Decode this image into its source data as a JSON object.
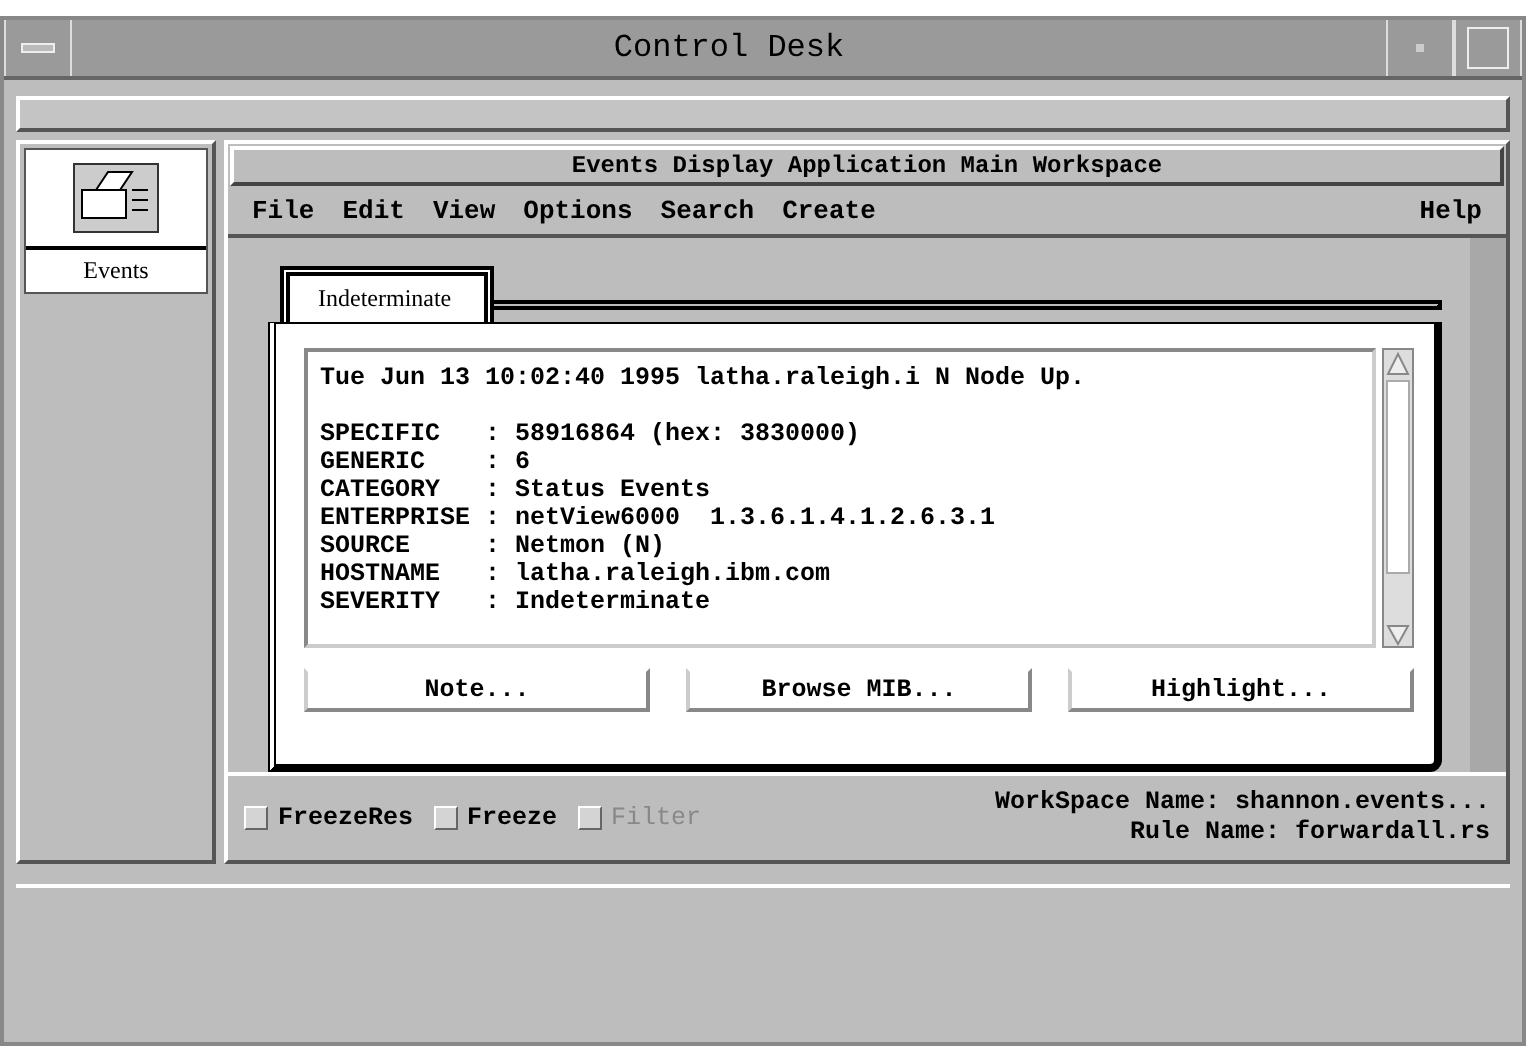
{
  "window": {
    "title": "Control Desk"
  },
  "sidebar": {
    "items": [
      {
        "label": "Events",
        "selected": true
      }
    ]
  },
  "app": {
    "title": "Events Display Application Main Workspace",
    "menu": [
      {
        "label": "File"
      },
      {
        "label": "Edit"
      },
      {
        "label": "View"
      },
      {
        "label": "Options"
      },
      {
        "label": "Search"
      },
      {
        "label": "Create"
      }
    ],
    "help_menu": {
      "label": "Help"
    },
    "tabs": [
      {
        "label": "Indeterminate",
        "selected": true
      }
    ],
    "event": {
      "summary": "Tue Jun 13 10:02:40 1995 latha.raleigh.i N Node Up.",
      "fields": [
        {
          "label": "SPECIFIC",
          "value": ": 58916864 (hex: 3830000)"
        },
        {
          "label": "GENERIC",
          "value": ": 6"
        },
        {
          "label": "CATEGORY",
          "value": ": Status Events"
        },
        {
          "label": "ENTERPRISE",
          "value": ": netView6000  1.3.6.1.4.1.2.6.3.1"
        },
        {
          "label": "SOURCE",
          "value": ": Netmon (N)"
        },
        {
          "label": "HOSTNAME",
          "value": ": latha.raleigh.ibm.com"
        },
        {
          "label": "SEVERITY",
          "value": ": Indeterminate"
        }
      ]
    },
    "buttons": [
      {
        "label": "Note..."
      },
      {
        "label": "Browse MIB..."
      },
      {
        "label": "Highlight..."
      }
    ],
    "checkboxes": [
      {
        "label": "FreezeRes",
        "checked": false,
        "disabled": false
      },
      {
        "label": "Freeze",
        "checked": false,
        "disabled": false
      },
      {
        "label": "Filter",
        "checked": false,
        "disabled": true
      }
    ],
    "status": {
      "workspace": "WorkSpace Name: shannon.events...",
      "rule": "Rule Name: forwardall.rs"
    }
  }
}
